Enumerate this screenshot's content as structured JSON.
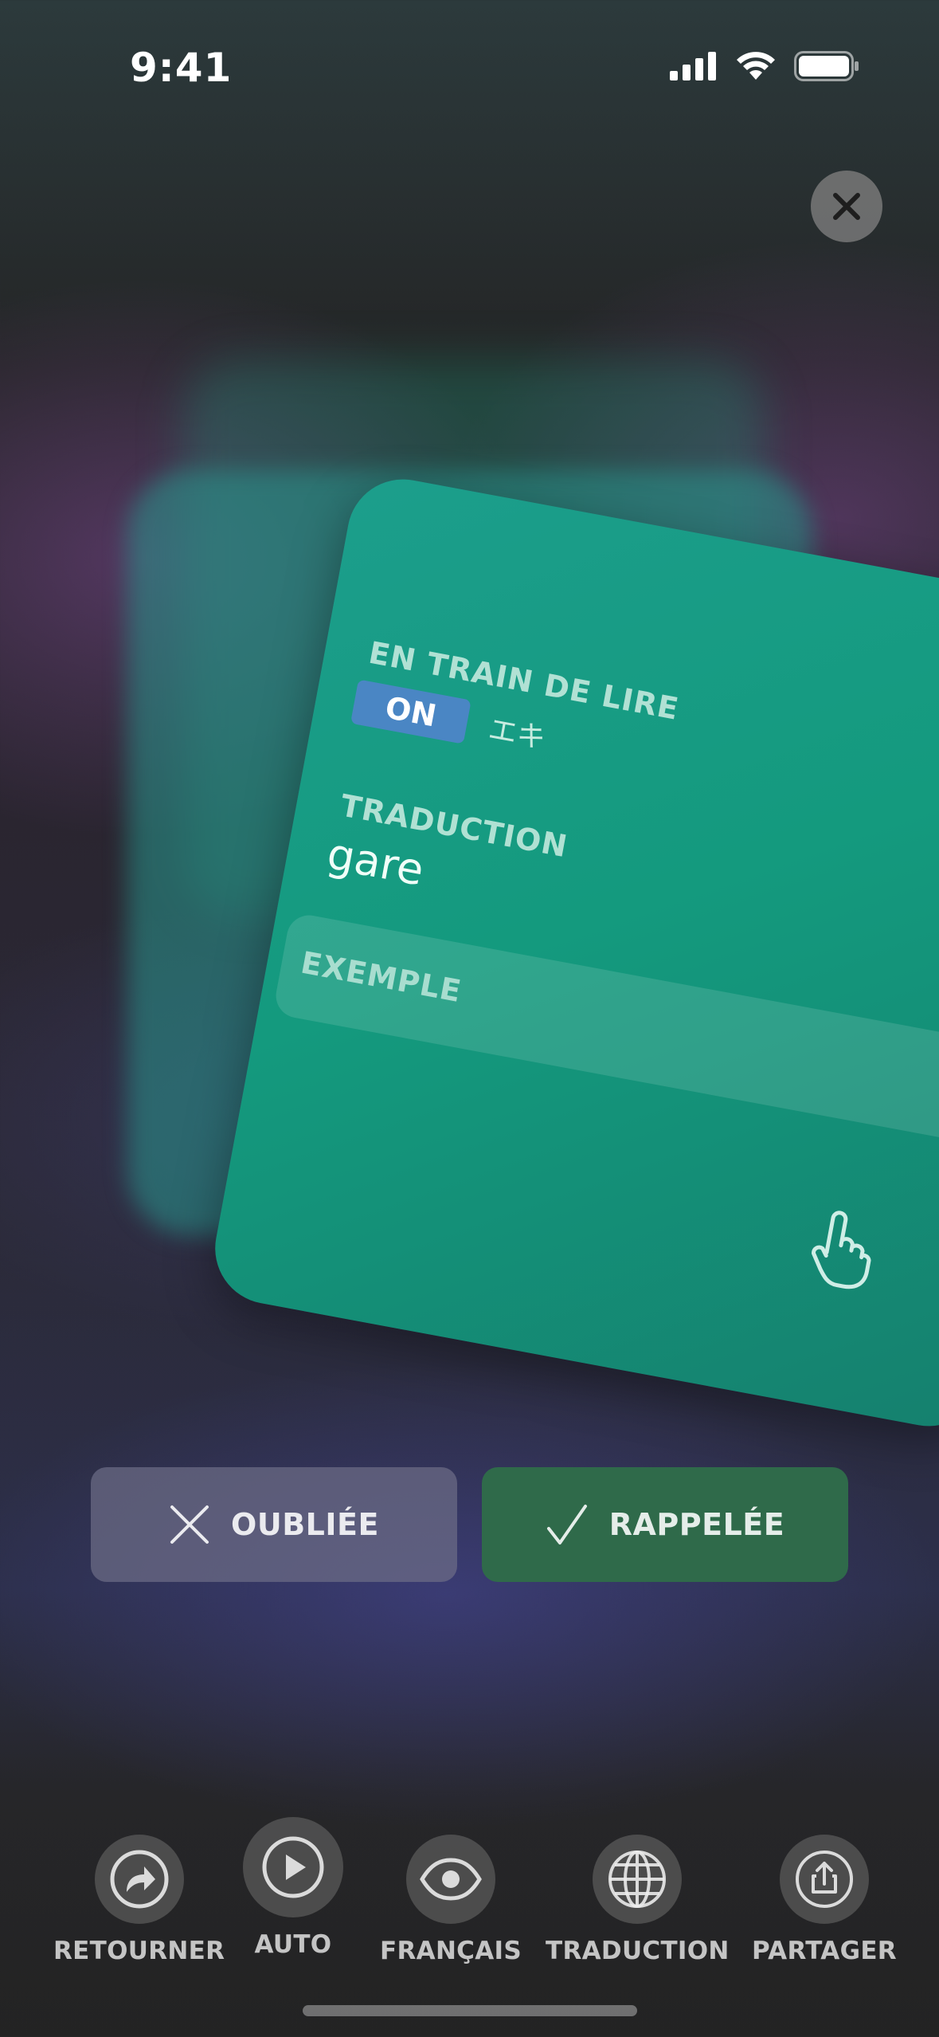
{
  "status_bar": {
    "time": "9:41"
  },
  "card": {
    "reading_label": "EN TRAIN DE LIRE",
    "reading_toggle": "ON",
    "reading_kana": "エキ",
    "translation_label": "TRADUCTION",
    "translation_value": "gare",
    "example_label": "EXEMPLE",
    "example_chevron": "‹"
  },
  "actions": {
    "forgot_label": "OUBLIÉE",
    "recalled_label": "RAPPELÉE"
  },
  "toolbar": {
    "items": [
      {
        "label": "RETOURNER",
        "icon": "flip-arrow-icon"
      },
      {
        "label": "AUTO",
        "icon": "play-icon"
      },
      {
        "label": "FRANÇAIS",
        "icon": "eye-icon"
      },
      {
        "label": "TRADUCTION",
        "icon": "globe-icon"
      },
      {
        "label": "PARTAGER",
        "icon": "share-icon"
      }
    ]
  },
  "colors": {
    "card": "#149a7e",
    "recalled": "#2f6a4a",
    "forgot": "#5c5c74",
    "toggle": "#4a86c4"
  }
}
